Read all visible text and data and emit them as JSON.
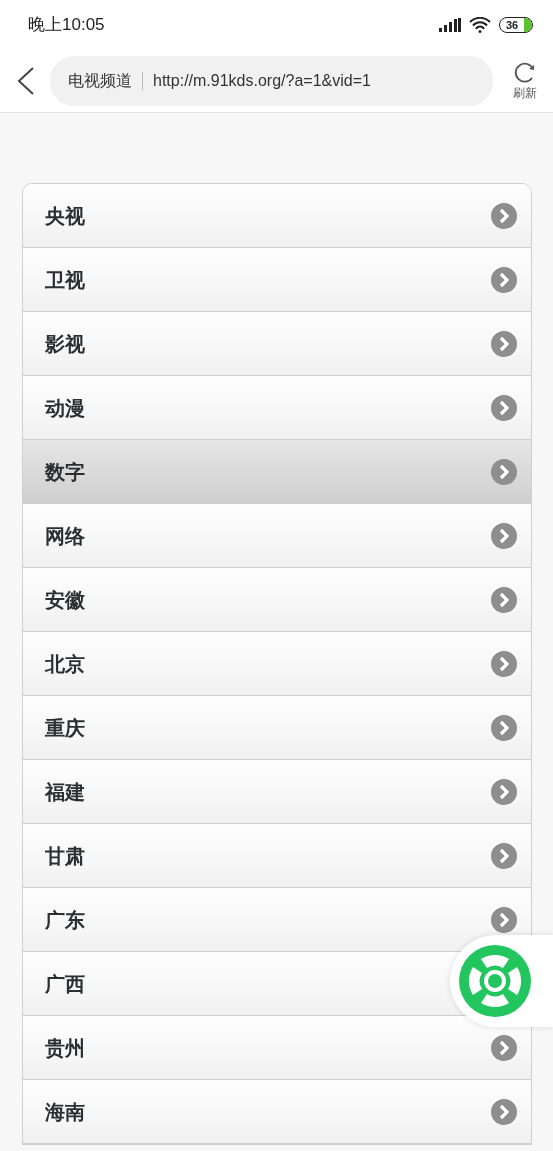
{
  "status_bar": {
    "time": "晚上10:05",
    "battery": "36"
  },
  "toolbar": {
    "page_title": "电视频道",
    "url": "http://m.91kds.org/?a=1&vid=1",
    "refresh_label": "刷新"
  },
  "channels": [
    {
      "label": "央视",
      "selected": false
    },
    {
      "label": "卫视",
      "selected": false
    },
    {
      "label": "影视",
      "selected": false
    },
    {
      "label": "动漫",
      "selected": false
    },
    {
      "label": "数字",
      "selected": true
    },
    {
      "label": "网络",
      "selected": false
    },
    {
      "label": "安徽",
      "selected": false
    },
    {
      "label": "北京",
      "selected": false
    },
    {
      "label": "重庆",
      "selected": false
    },
    {
      "label": "福建",
      "selected": false
    },
    {
      "label": "甘肃",
      "selected": false
    },
    {
      "label": "广东",
      "selected": false
    },
    {
      "label": "广西",
      "selected": false
    },
    {
      "label": "贵州",
      "selected": false
    },
    {
      "label": "海南",
      "selected": false
    }
  ]
}
